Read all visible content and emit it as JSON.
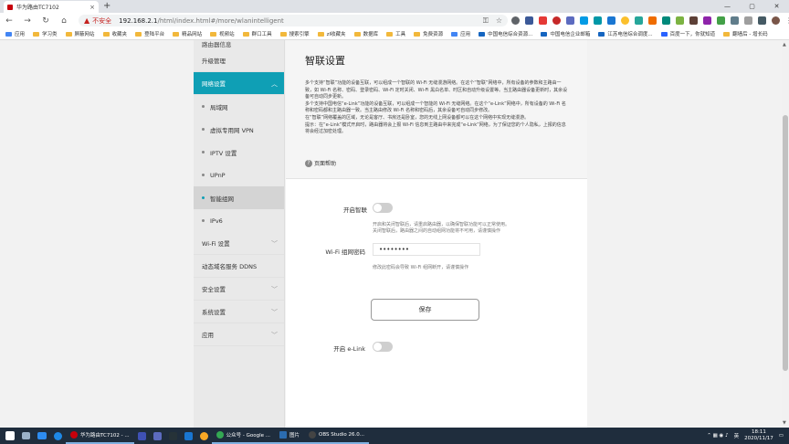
{
  "browser": {
    "tab_title": "华为路由TC7102",
    "tab_close": "×",
    "new_tab": "+",
    "window_controls": [
      "—",
      "▢",
      "✕"
    ],
    "insecure_label": "不安全",
    "url_host": "192.168.2.1",
    "url_path": "/html/index.html#/more/wlanintelligent",
    "bookmarks": [
      "应用",
      "学习类",
      "屏蔽网站",
      "收藏夹",
      "登陆平台",
      "精品网站",
      "视频站",
      "群口工具",
      "搜索引擎",
      "zl收藏夹",
      "数据库",
      "工具",
      "免费资源",
      "应用",
      "中国电信综合资源...",
      "中国电信企业邮箱",
      "江苏电信综合调度...",
      "百度一下，你就知道",
      "翻墙后 - 增长码"
    ]
  },
  "sidebar": {
    "top_item": "路由器信息",
    "items": [
      {
        "label": "升级管理",
        "chev": ""
      },
      {
        "label": "网络设置",
        "chev": "︿",
        "active": true
      }
    ],
    "sub_items": [
      "局域网",
      "虚拟专用网 VPN",
      "IPTV 设置",
      "UPnP",
      "智能组网",
      "IPv6"
    ],
    "bottom_items": [
      {
        "label": "Wi-Fi 设置",
        "chev": "﹀"
      },
      {
        "label": "动态域名服务 DDNS",
        "chev": ""
      },
      {
        "label": "安全设置",
        "chev": "﹀"
      },
      {
        "label": "系统设置",
        "chev": "﹀"
      },
      {
        "label": "应用",
        "chev": "﹀"
      }
    ]
  },
  "main": {
    "title": "智联设置",
    "description": [
      "多个支持“智联”功能的设备互联，可以组成一个智联的 Wi-Fi 无缝漫游网络。在这个“智联”网络中，所有设备的参数和主路由一致，如 Wi-Fi 名称、密码、登录密码、Wi-Fi 定时关闭、Wi-Fi 黑白名单、时区和自动升级设置等。当主路由器设备更新时，其余设备可自动同步更新。",
      "多个支持中国电信“e-Link”功能的设备互联，可以组成一个智能的 Wi-Fi 无缝网络。在这个“e-Link”网络中，所有设备的 Wi-Fi 名称和密码都和主路由器一致。当主路由修改 Wi-Fi 名称和密码后，其余设备可自动同步修改。",
      "在“智联”网络覆盖的区域，无论是客厅、书房还是卧室，您的无线上网设备都可以在这个网络中实现无缝漫游。",
      "提示：在“e-Link”模式开启时，路由器将会上报 Wi-Fi 信息到主路由中来完成“e-Link”网络，为了保证您的个人隐私，上报的信息将会经过加密处理。"
    ],
    "help_label": "页面帮助",
    "smart_link_label": "开启智联",
    "smart_link_note_1": "开启和关闭智联后，请重启路由器，以确保智联功能可以正常使用。",
    "smart_link_note_2": "关闭智联后，路由器之间的自动组网功能将不可用，请谨慎操作",
    "wifi_password_label": "Wi-Fi 组网密码",
    "wifi_password_value": "••••••••",
    "wifi_password_note": "修改此密码会导致 Wi-Fi 组网断开，请谨慎操作",
    "save_label": "保存",
    "elink_label": "开启 e-Link"
  },
  "taskbar": {
    "apps": [
      {
        "label": "华为路由TC7102 - ...",
        "color": "#c7000b"
      },
      {
        "label": "公众号 - Google ...",
        "color": "#34a853"
      },
      {
        "label": "图片",
        "color": "#2b6cb0"
      },
      {
        "label": "OBS Studio 26.0...",
        "color": "#444444"
      }
    ],
    "tray_lang": "英",
    "time": "18:11",
    "date": "2020/11/17"
  }
}
